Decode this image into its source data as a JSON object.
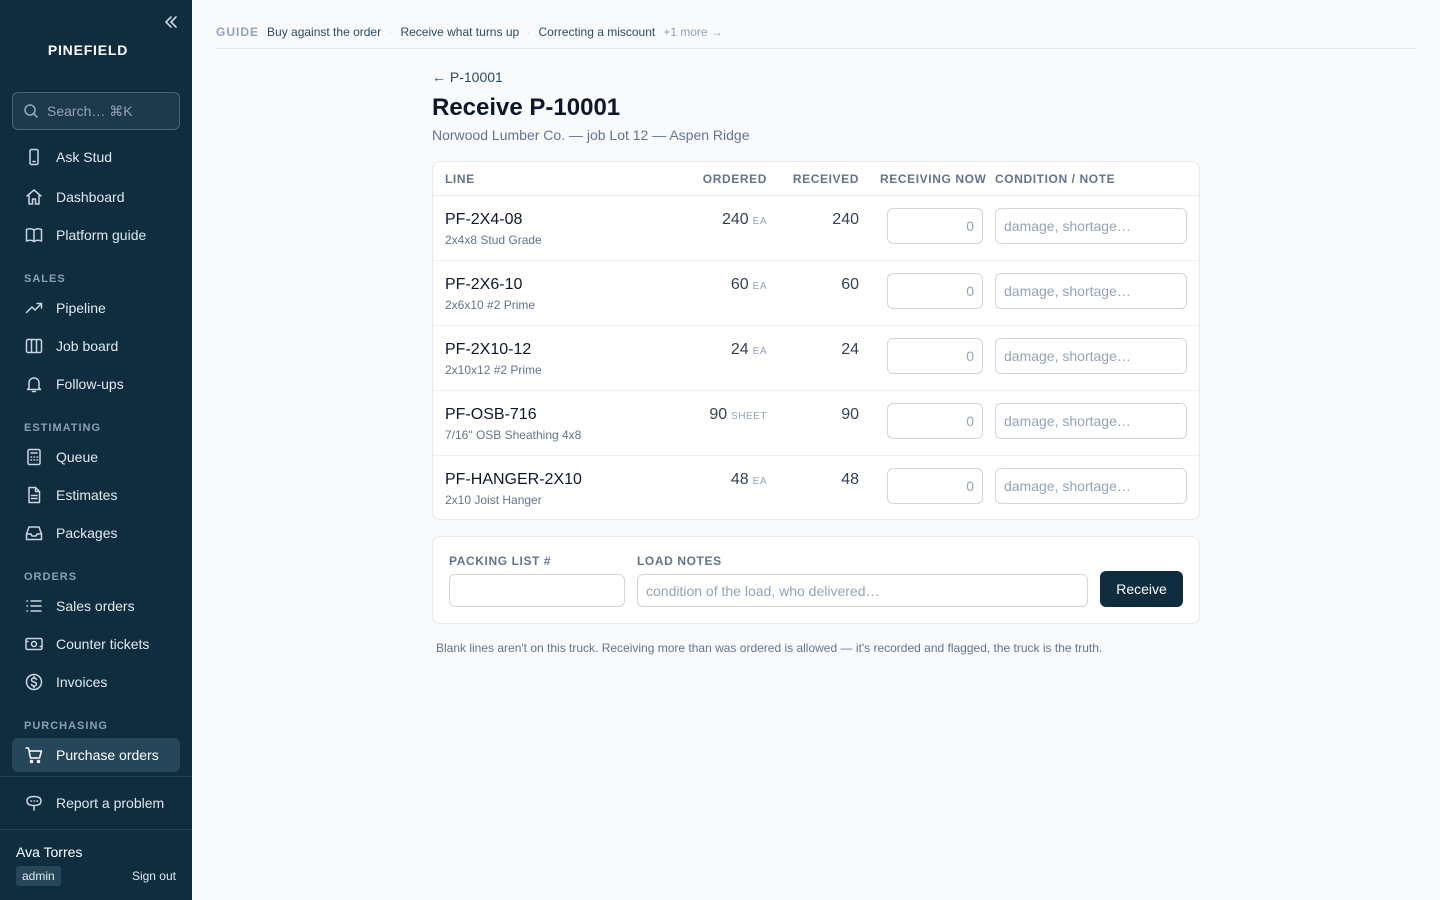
{
  "sidebar": {
    "brand": "PINEFIELD",
    "search_placeholder": "Search…  ⌘K",
    "top_items": [
      {
        "label": "Ask Stud",
        "icon": "phone-icon"
      },
      {
        "label": "Dashboard",
        "icon": "home-icon"
      },
      {
        "label": "Platform guide",
        "icon": "book-icon"
      }
    ],
    "sections": [
      {
        "label": "SALES",
        "items": [
          {
            "label": "Pipeline",
            "icon": "trend-icon"
          },
          {
            "label": "Job board",
            "icon": "columns-icon"
          },
          {
            "label": "Follow-ups",
            "icon": "bell-icon"
          }
        ]
      },
      {
        "label": "ESTIMATING",
        "items": [
          {
            "label": "Queue",
            "icon": "calculator-icon"
          },
          {
            "label": "Estimates",
            "icon": "document-icon"
          },
          {
            "label": "Packages",
            "icon": "inbox-icon"
          }
        ]
      },
      {
        "label": "ORDERS",
        "items": [
          {
            "label": "Sales orders",
            "icon": "list-icon"
          },
          {
            "label": "Counter tickets",
            "icon": "cash-icon"
          },
          {
            "label": "Invoices",
            "icon": "dollar-icon"
          }
        ]
      },
      {
        "label": "PURCHASING",
        "items": [
          {
            "label": "Purchase orders",
            "icon": "cart-icon",
            "active": true
          }
        ]
      }
    ],
    "report_label": "Report a problem",
    "user": {
      "name": "Ava Torres",
      "role": "admin",
      "sign_out": "Sign out"
    }
  },
  "guide": {
    "label": "GUIDE",
    "links": [
      "Buy against the order",
      "Receive what turns up",
      "Correcting a miscount"
    ],
    "more": "+1 more →"
  },
  "header": {
    "back_link": "← P-10001",
    "title": "Receive P-10001",
    "subtitle": "Norwood Lumber Co. — job Lot 12 — Aspen Ridge"
  },
  "table": {
    "columns": {
      "line": "LINE",
      "ordered": "ORDERED",
      "received": "RECEIVED",
      "receiving_now": "RECEIVING NOW",
      "condition": "CONDITION / NOTE"
    },
    "qty_placeholder": "0",
    "note_placeholder": "damage, shortage…",
    "rows": [
      {
        "sku": "PF-2X4-08",
        "desc": "2x4x8 Stud Grade",
        "ordered": "240",
        "unit": "EA",
        "received": "240"
      },
      {
        "sku": "PF-2X6-10",
        "desc": "2x6x10 #2 Prime",
        "ordered": "60",
        "unit": "EA",
        "received": "60"
      },
      {
        "sku": "PF-2X10-12",
        "desc": "2x10x12 #2 Prime",
        "ordered": "24",
        "unit": "EA",
        "received": "24"
      },
      {
        "sku": "PF-OSB-716",
        "desc": "7/16\" OSB Sheathing 4x8",
        "ordered": "90",
        "unit": "SHEET",
        "received": "90"
      },
      {
        "sku": "PF-HANGER-2X10",
        "desc": "2x10 Joist Hanger",
        "ordered": "48",
        "unit": "EA",
        "received": "48"
      }
    ]
  },
  "receive_form": {
    "packing_label": "PACKING LIST #",
    "packing_value": "",
    "load_label": "LOAD NOTES",
    "load_placeholder": "condition of the load, who delivered…",
    "button": "Receive"
  },
  "footnote": "Blank lines aren't on this truck. Receiving more than was ordered is allowed — it's recorded and flagged, the truck is the truth.",
  "colors": {
    "sidebar_bg": "#0f2d3f",
    "active_item_bg": "#26465a",
    "primary_button": "#0f2d3f",
    "link": "#2b4c64"
  }
}
